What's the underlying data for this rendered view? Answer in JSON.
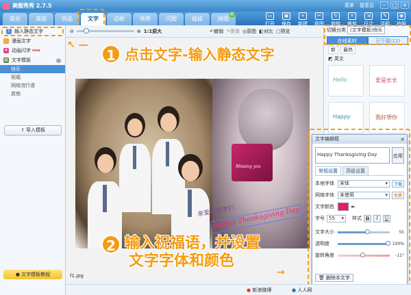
{
  "app": {
    "title": "美图秀秀 2.7.5",
    "menu": [
      "菜单",
      "提意见"
    ]
  },
  "tabs": [
    "美化",
    "美容",
    "饰品",
    "文字",
    "边框",
    "场景",
    "闪图",
    "娃娃",
    "拼图"
  ],
  "tab_badge": "新",
  "tools": [
    "打开",
    "保存",
    "新建",
    "抠图",
    "旋转",
    "裁剪",
    "尺寸",
    "涂鸦",
    "拍照"
  ],
  "sidebar": {
    "items": [
      {
        "label": "输入静态文字",
        "new": ""
      },
      {
        "label": "漫画文字",
        "new": ""
      },
      {
        "label": "动画闪字",
        "new": "new"
      },
      {
        "label": "文字模板",
        "new": ""
      }
    ],
    "subitems": [
      "快乐",
      "祝福",
      "网络流行语",
      "其他"
    ],
    "import_label": "导入模板",
    "tutorial_label": "文字模板教程"
  },
  "toolbar": {
    "zoom": "1:1原大",
    "undo": "撤销",
    "redo": "重做",
    "original": "原图",
    "compare": "对比",
    "preview": "预览"
  },
  "canvas": {
    "dedication": "亲爱的同学们:",
    "filename": "f1.jpg",
    "gift_text": "Missing you"
  },
  "rightpanel": {
    "category_label": "切换分类",
    "category_value": "(文字模板)快乐",
    "tabs": [
      "在线素材",
      "已下载(12)"
    ],
    "subtabs": [
      "新",
      "最热"
    ],
    "lang": "英文",
    "thumb_texts": [
      "Hello",
      "爱是长长",
      "Happy",
      "我好想你"
    ]
  },
  "dialog": {
    "title": "文字编辑框",
    "text_value": "Happy Thanksgiving Day",
    "apply": "应用",
    "tabs": [
      "常规设置",
      "高级设置"
    ],
    "local_font_label": "本地字体",
    "local_font_value": "宋体",
    "download": "下载",
    "web_font_label": "网络字体",
    "web_font_value": "未使用",
    "free": "免费",
    "color_label": "文字颜色",
    "color_value": "#e81a6a",
    "size_label": "字号",
    "size_value": "55",
    "style_label": "样式",
    "bold": "B",
    "italic": "I",
    "underline": "U",
    "text_size_label": "文字大小",
    "text_size_value": 55,
    "opacity_label": "透明度",
    "opacity_value": "100%",
    "rotation_label": "旋转角度",
    "rotation_value": "-11°",
    "delete_label": "删除本文字"
  },
  "status": {
    "weibo": "新浪微博",
    "renren": "人人网"
  },
  "callouts": {
    "step1_num": "1",
    "step1_text": "点击文字-输入静态文字",
    "step2_num": "2",
    "step2_line1": "输入祝福语，并设置",
    "step2_line2": "文字字体和颜色"
  }
}
